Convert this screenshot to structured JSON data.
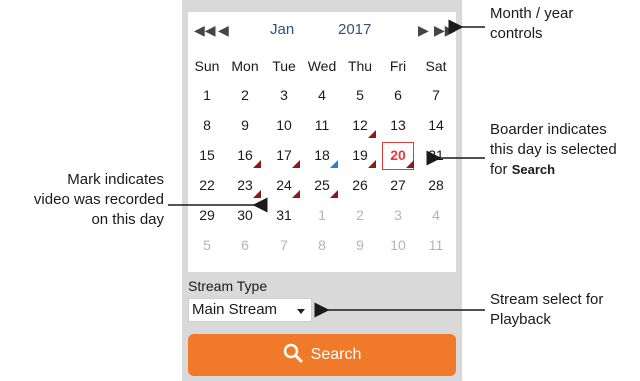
{
  "calendar": {
    "month": "Jan",
    "year": "2017",
    "weekdays": [
      "Sun",
      "Mon",
      "Tue",
      "Wed",
      "Thu",
      "Fri",
      "Sat"
    ],
    "weeks": [
      [
        {
          "d": "1"
        },
        {
          "d": "2"
        },
        {
          "d": "3"
        },
        {
          "d": "4"
        },
        {
          "d": "5"
        },
        {
          "d": "6"
        },
        {
          "d": "7"
        }
      ],
      [
        {
          "d": "8"
        },
        {
          "d": "9"
        },
        {
          "d": "10"
        },
        {
          "d": "11"
        },
        {
          "d": "12",
          "mark": "rec"
        },
        {
          "d": "13"
        },
        {
          "d": "14"
        }
      ],
      [
        {
          "d": "15"
        },
        {
          "d": "16",
          "mark": "rec"
        },
        {
          "d": "17",
          "mark": "rec"
        },
        {
          "d": "18",
          "mark": "blue"
        },
        {
          "d": "19",
          "mark": "rec"
        },
        {
          "d": "20",
          "mark": "rec",
          "selected": true
        },
        {
          "d": "21"
        }
      ],
      [
        {
          "d": "22"
        },
        {
          "d": "23",
          "mark": "rec"
        },
        {
          "d": "24",
          "mark": "rec"
        },
        {
          "d": "25",
          "mark": "rec"
        },
        {
          "d": "26"
        },
        {
          "d": "27"
        },
        {
          "d": "28"
        }
      ],
      [
        {
          "d": "29"
        },
        {
          "d": "30"
        },
        {
          "d": "31"
        },
        {
          "d": "1",
          "other": true
        },
        {
          "d": "2",
          "other": true
        },
        {
          "d": "3",
          "other": true
        },
        {
          "d": "4",
          "other": true
        }
      ],
      [
        {
          "d": "5",
          "other": true
        },
        {
          "d": "6",
          "other": true
        },
        {
          "d": "7",
          "other": true
        },
        {
          "d": "8",
          "other": true
        },
        {
          "d": "9",
          "other": true
        },
        {
          "d": "10",
          "other": true
        },
        {
          "d": "11",
          "other": true
        }
      ]
    ]
  },
  "stream": {
    "label": "Stream Type",
    "value": "Main Stream"
  },
  "search": {
    "label": "Search"
  },
  "annotations": {
    "month_year": [
      "Month / year",
      "controls"
    ],
    "selected": [
      "Boarder indicates",
      "this day is selected",
      "for ",
      "Search"
    ],
    "recorded": [
      "Mark indicates",
      "video was recorded",
      "on this day"
    ],
    "stream": [
      "Stream select for",
      "Playback"
    ]
  },
  "colors": {
    "accent": "#f0792a",
    "selected": "#e03c3c",
    "record_mark": "#8b1a1a",
    "today_mark": "#2d7fd6"
  }
}
